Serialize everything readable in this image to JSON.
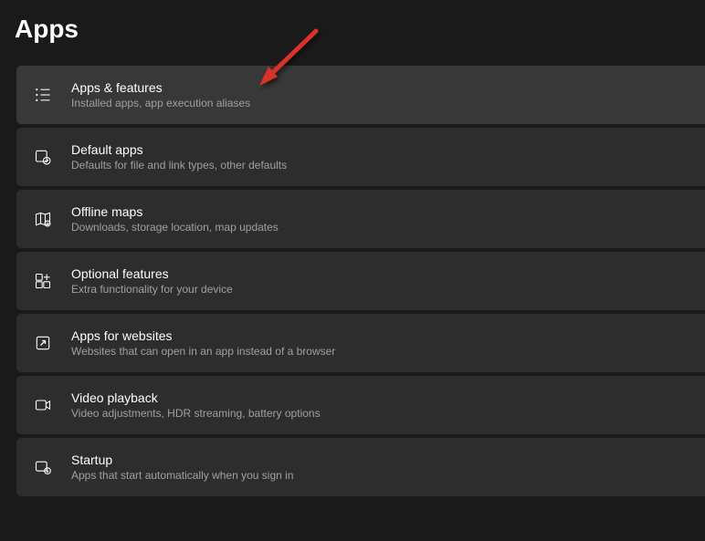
{
  "page": {
    "title": "Apps"
  },
  "items": [
    {
      "id": "apps-features",
      "title": "Apps & features",
      "subtitle": "Installed apps, app execution aliases",
      "highlight": true
    },
    {
      "id": "default-apps",
      "title": "Default apps",
      "subtitle": "Defaults for file and link types, other defaults",
      "highlight": false
    },
    {
      "id": "offline-maps",
      "title": "Offline maps",
      "subtitle": "Downloads, storage location, map updates",
      "highlight": false
    },
    {
      "id": "optional-features",
      "title": "Optional features",
      "subtitle": "Extra functionality for your device",
      "highlight": false
    },
    {
      "id": "apps-websites",
      "title": "Apps for websites",
      "subtitle": "Websites that can open in an app instead of a browser",
      "highlight": false
    },
    {
      "id": "video-playback",
      "title": "Video playback",
      "subtitle": "Video adjustments, HDR streaming, battery options",
      "highlight": false
    },
    {
      "id": "startup",
      "title": "Startup",
      "subtitle": "Apps that start automatically when you sign in",
      "highlight": false
    }
  ],
  "annotation": {
    "type": "arrow",
    "color": "#d93025"
  }
}
